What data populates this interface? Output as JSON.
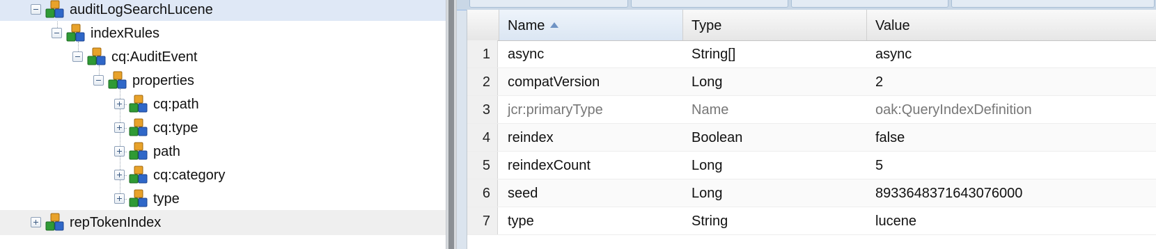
{
  "tree": {
    "nodes": [
      {
        "label": "auditLogSearchLucene",
        "expanded": true,
        "selected": true
      },
      {
        "label": "indexRules",
        "expanded": true
      },
      {
        "label": "cq:AuditEvent",
        "expanded": true
      },
      {
        "label": "properties",
        "expanded": true
      },
      {
        "label": "cq:path",
        "expanded": false
      },
      {
        "label": "cq:type",
        "expanded": false
      },
      {
        "label": "path",
        "expanded": false
      },
      {
        "label": "cq:category",
        "expanded": false
      },
      {
        "label": "type",
        "expanded": false
      },
      {
        "label": "repTokenIndex",
        "expanded": false
      }
    ],
    "node_icon": "jcr-node-icon"
  },
  "grid": {
    "columns": [
      {
        "label": "Name",
        "sorted": "asc"
      },
      {
        "label": "Type"
      },
      {
        "label": "Value"
      }
    ],
    "rows": [
      {
        "num": "1",
        "name": "async",
        "type": "String[]",
        "value": "async"
      },
      {
        "num": "2",
        "name": "compatVersion",
        "type": "Long",
        "value": "2"
      },
      {
        "num": "3",
        "name": "jcr:primaryType",
        "type": "Name",
        "value": "oak:QueryIndexDefinition",
        "protected": true
      },
      {
        "num": "4",
        "name": "reindex",
        "type": "Boolean",
        "value": "false"
      },
      {
        "num": "5",
        "name": "reindexCount",
        "type": "Long",
        "value": "5"
      },
      {
        "num": "6",
        "name": "seed",
        "type": "Long",
        "value": "8933648371643076000"
      },
      {
        "num": "7",
        "name": "type",
        "type": "String",
        "value": "lucene"
      }
    ]
  },
  "colors": {
    "selected_row": "#dfe8f6",
    "header_accent": "#6f93c4",
    "protected_text": "#777777"
  }
}
